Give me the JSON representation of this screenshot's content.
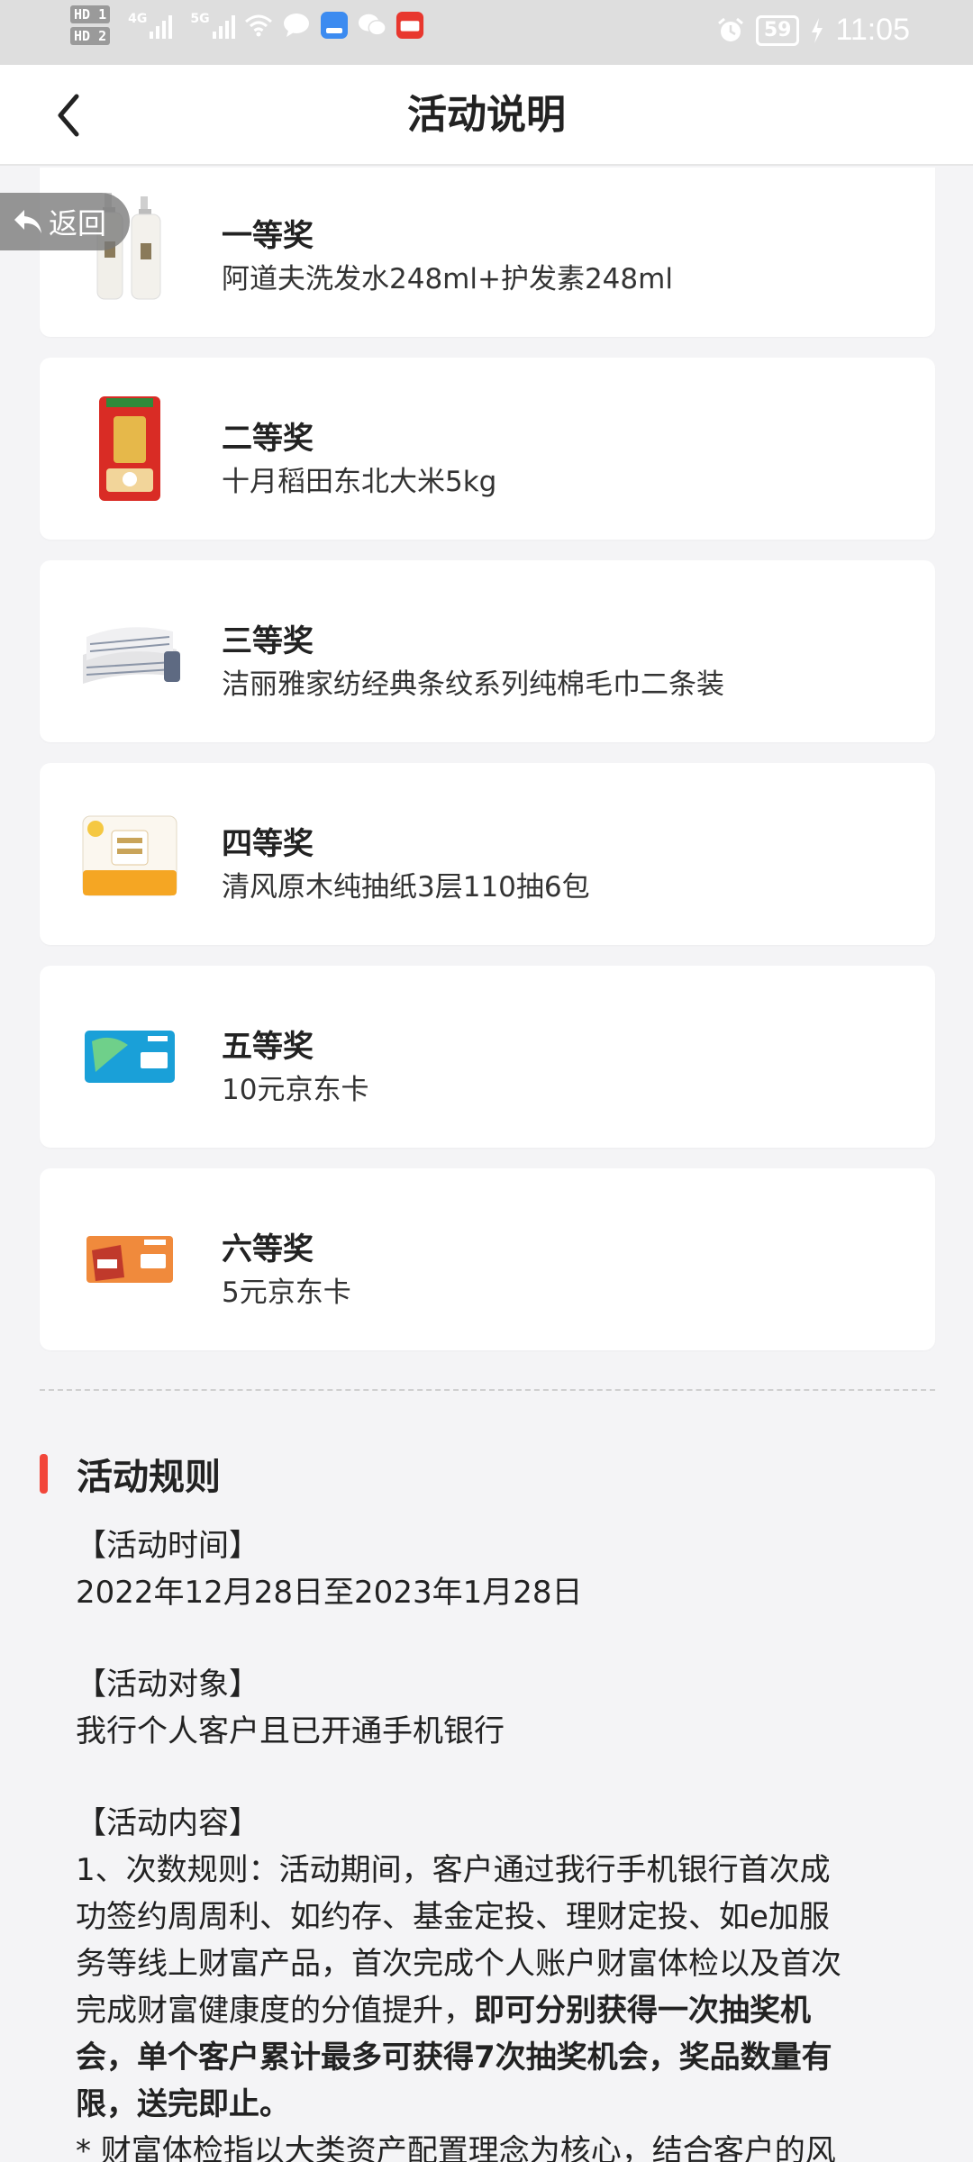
{
  "status_bar": {
    "hd1": "HD 1",
    "hd2": "HD 2",
    "net1": "4G",
    "net2": "5G",
    "battery": "59",
    "time": "11:05"
  },
  "nav": {
    "title": "活动说明"
  },
  "float_back": {
    "label": "返回"
  },
  "prizes": [
    {
      "level": "一等奖",
      "name": "阿道夫洗发水248ml+护发素248ml"
    },
    {
      "level": "二等奖",
      "name": "十月稻田东北大米5kg"
    },
    {
      "level": "三等奖",
      "name": "洁丽雅家纺经典条纹系列纯棉毛巾二条装"
    },
    {
      "level": "四等奖",
      "name": "清风原木纯抽纸3层110抽6包"
    },
    {
      "level": "五等奖",
      "name": "10元京东卡"
    },
    {
      "level": "六等奖",
      "name": "5元京东卡"
    }
  ],
  "rules": {
    "title": "活动规则",
    "time_label": "【活动时间】",
    "time_value": "2022年12月28日至2023年1月28日",
    "target_label": "【活动对象】",
    "target_value": "我行个人客户且已开通手机银行",
    "content_label": "【活动内容】",
    "content_1_lines": [
      "1、次数规则：活动期间，客户通过我行手机银行首次成",
      "功签约周周利、如约存、基金定投、理财定投、如e加服",
      "务等线上财富产品，首次完成个人账户财富体检以及首次"
    ],
    "content_1_line4_normal": "完成财富健康度的分值提升，",
    "content_1_line4_bold": "即可分别获得一次抽奖机",
    "content_1_bold_lines": [
      "会，单个客户累计最多可获得7次抽奖机会，奖品数量有",
      "限，送完即止。"
    ],
    "content_note": "* 财富体检指以大类资产配置理念为核心，结合客户的风"
  }
}
